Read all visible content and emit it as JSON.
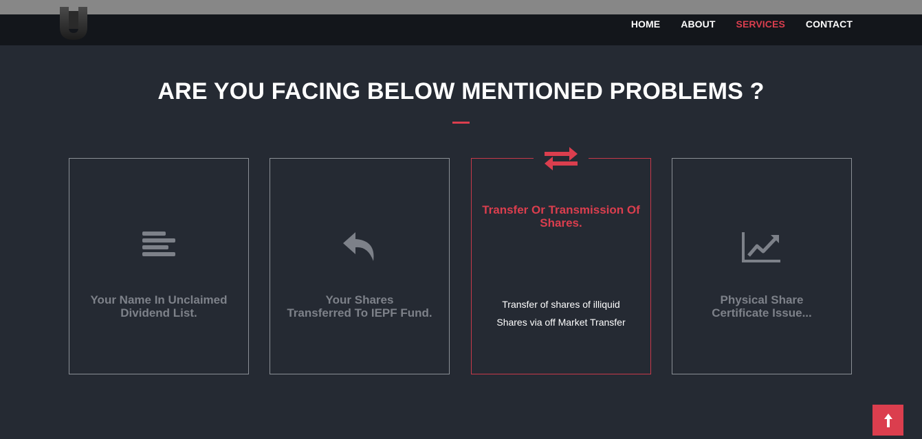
{
  "nav": {
    "items": [
      {
        "label": "HOME",
        "active": false
      },
      {
        "label": "ABOUT",
        "active": false
      },
      {
        "label": "SERVICES",
        "active": true
      },
      {
        "label": "CONTACT",
        "active": false
      }
    ]
  },
  "heading": "ARE YOU FACING BELOW MENTIONED PROBLEMS ?",
  "cards": [
    {
      "icon": "align-left-icon",
      "label_line1": "Your Name In Unclaimed",
      "label_line2": "Dividend List."
    },
    {
      "icon": "reply-icon",
      "label_line1": "Your Shares",
      "label_line2": "Transferred To IEPF Fund."
    },
    {
      "icon": "exchange-arrows-icon",
      "title_line1": "Transfer Or Transmission Of",
      "title_line2": "Shares.",
      "desc_line1": "Transfer of shares of illiquid",
      "desc_line2": "Shares via off Market Transfer"
    },
    {
      "icon": "line-chart-icon",
      "label_line1": "Physical Share",
      "label_line2": "Certificate Issue..."
    }
  ],
  "colors": {
    "accent": "#db3e4e",
    "background": "#252a33",
    "navbar": "#13161b",
    "muted_text": "#7d8189"
  }
}
